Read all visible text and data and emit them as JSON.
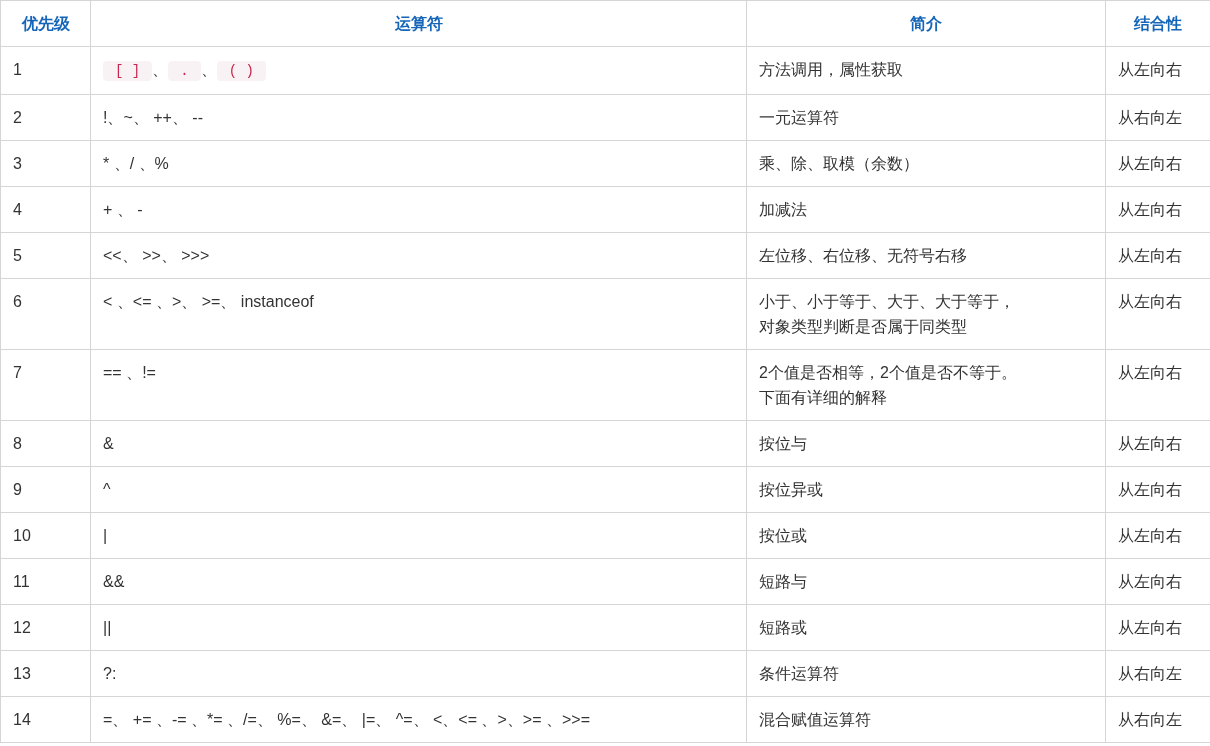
{
  "table": {
    "columns": [
      "优先级",
      "运算符",
      "简介",
      "结合性"
    ],
    "rows": [
      {
        "priority": "1",
        "operator": [
          {
            "kind": "code",
            "text": "[ ]"
          },
          {
            "kind": "text",
            "text": "、"
          },
          {
            "kind": "code",
            "text": "."
          },
          {
            "kind": "text",
            "text": "、"
          },
          {
            "kind": "code",
            "text": "( )"
          }
        ],
        "description": "方法调用，属性获取",
        "associativity": "从左向右"
      },
      {
        "priority": "2",
        "operator": [
          {
            "kind": "text",
            "text": "!、~、 ++、 --"
          }
        ],
        "description": "一元运算符",
        "associativity": "从右向左"
      },
      {
        "priority": "3",
        "operator": [
          {
            "kind": "text",
            "text": "* 、/ 、%"
          }
        ],
        "description": "乘、除、取模（余数）",
        "associativity": "从左向右"
      },
      {
        "priority": "4",
        "operator": [
          {
            "kind": "text",
            "text": "+ 、 -"
          }
        ],
        "description": "加减法",
        "associativity": "从左向右"
      },
      {
        "priority": "5",
        "operator": [
          {
            "kind": "text",
            "text": "<<、 >>、 >>>"
          }
        ],
        "description": "左位移、右位移、无符号右移",
        "associativity": "从左向右"
      },
      {
        "priority": "6",
        "operator": [
          {
            "kind": "text",
            "text": "< 、<= 、>、 >=、 instanceof"
          }
        ],
        "description": [
          "小于、小于等于、大于、大于等于，",
          "对象类型判断是否属于同类型"
        ],
        "associativity": "从左向右"
      },
      {
        "priority": "7",
        "operator": [
          {
            "kind": "text",
            "text": "== 、!="
          }
        ],
        "description": [
          "2个值是否相等，2个值是否不等于。",
          "下面有详细的解释"
        ],
        "associativity": "从左向右"
      },
      {
        "priority": "8",
        "operator": [
          {
            "kind": "text",
            "text": "&"
          }
        ],
        "description": "按位与",
        "associativity": "从左向右"
      },
      {
        "priority": "9",
        "operator": [
          {
            "kind": "text",
            "text": "^"
          }
        ],
        "description": "按位异或",
        "associativity": "从左向右"
      },
      {
        "priority": "10",
        "operator": [
          {
            "kind": "text",
            "text": "|"
          }
        ],
        "description": "按位或",
        "associativity": "从左向右"
      },
      {
        "priority": "11",
        "operator": [
          {
            "kind": "text",
            "text": "&&"
          }
        ],
        "description": "短路与",
        "associativity": "从左向右"
      },
      {
        "priority": "12",
        "operator": [
          {
            "kind": "text",
            "text": "||"
          }
        ],
        "description": "短路或",
        "associativity": "从左向右"
      },
      {
        "priority": "13",
        "operator": [
          {
            "kind": "text",
            "text": "?:"
          }
        ],
        "description": "条件运算符",
        "associativity": "从右向左"
      },
      {
        "priority": "14",
        "operator": [
          {
            "kind": "text",
            "text": "=、 += 、-= 、*= 、/=、 %=、 &=、 |=、 ^=、 <、<= 、>、>= 、>>="
          }
        ],
        "description": "混合赋值运算符",
        "associativity": "从右向左"
      }
    ]
  }
}
